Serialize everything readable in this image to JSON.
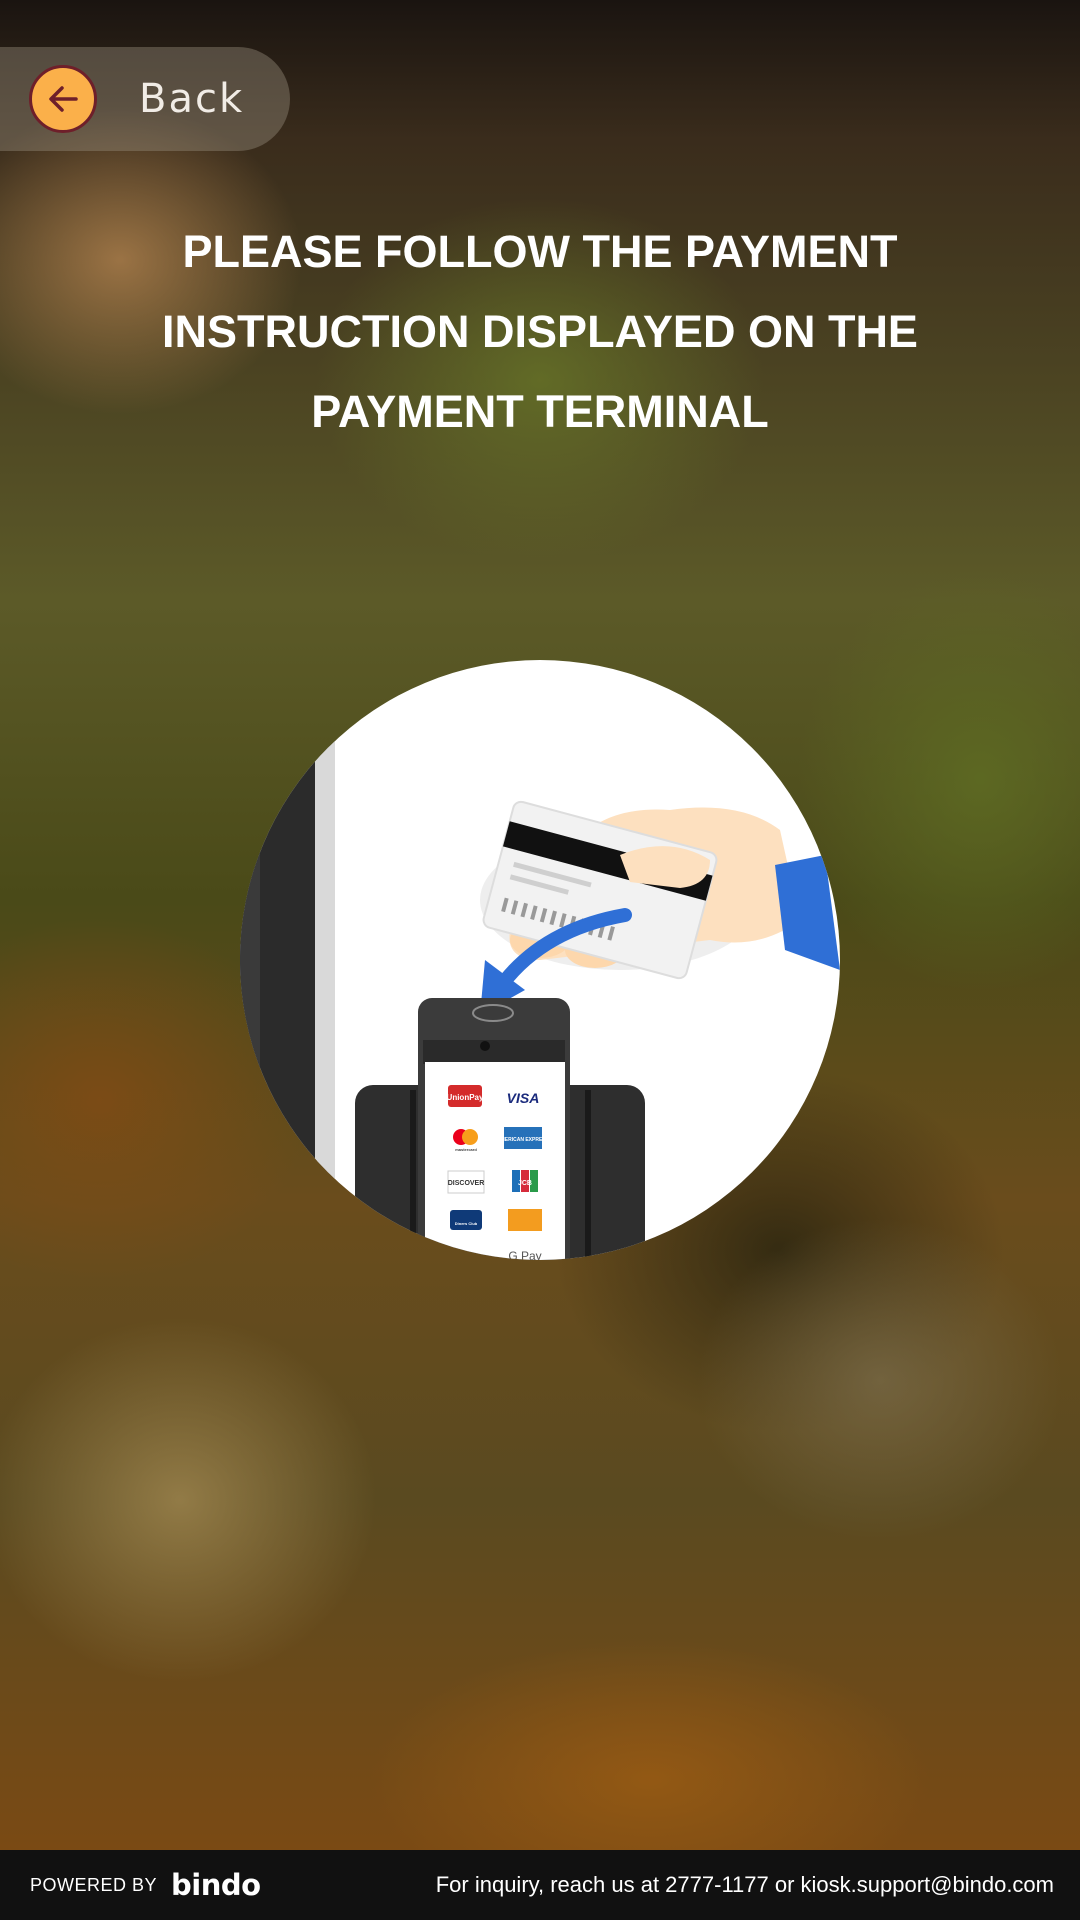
{
  "header": {
    "back_label": "Back"
  },
  "instruction": "PLEASE FOLLOW THE PAYMENT INSTRUCTION DISPLAYED ON THE PAYMENT TERMINAL",
  "terminal": {
    "card_brands": [
      "UnionPay",
      "VISA",
      "mastercard",
      "AMERICAN EXPRESS",
      "DISCOVER",
      "JCB",
      "Diners Club",
      "",
      "Pay",
      "G Pay"
    ]
  },
  "footer": {
    "powered_by": "POWERED BY",
    "brand": "bindo",
    "inquiry": "For inquiry, reach us at 2777-1177 or  kiosk.support@bindo.com"
  },
  "colors": {
    "accent": "#fbb04a",
    "accent_border": "#6e1f2a",
    "footer_bg": "#111111",
    "arrow": "#2f6fd6"
  }
}
